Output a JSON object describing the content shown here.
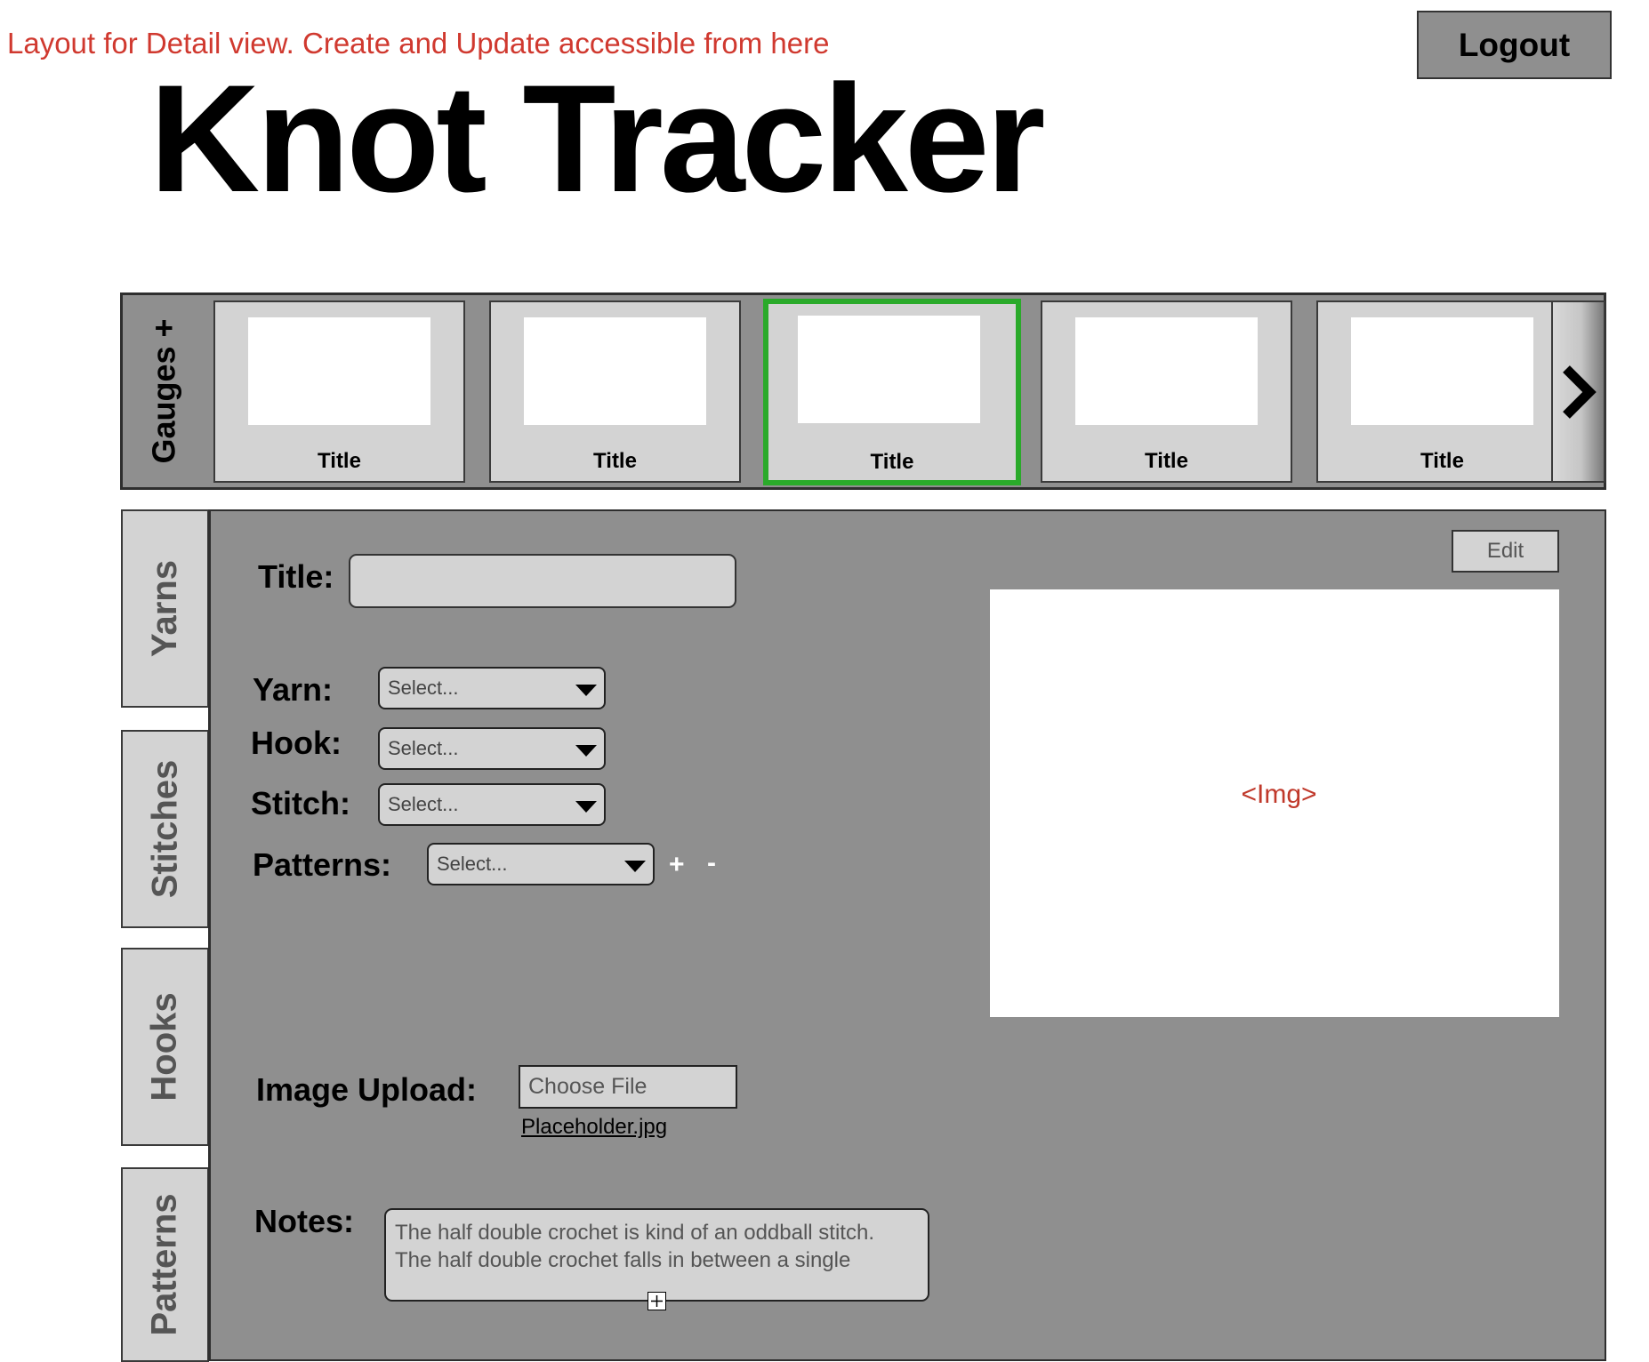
{
  "header": {
    "note": "Layout for Detail view. Create and Update accessible from here",
    "app_title": "Knot Tracker",
    "logout_label": "Logout"
  },
  "gauges": {
    "label": "Gauges",
    "add_label": "+",
    "cards": [
      {
        "title": "Title",
        "selected": false
      },
      {
        "title": "Title",
        "selected": false
      },
      {
        "title": "Title",
        "selected": true
      },
      {
        "title": "Title",
        "selected": false
      },
      {
        "title": "Title",
        "selected": false
      }
    ],
    "selected_color": "#2aaa2a"
  },
  "sidebar": {
    "tabs": [
      {
        "label": "Yarns"
      },
      {
        "label": "Stitches"
      },
      {
        "label": "Hooks"
      },
      {
        "label": "Patterns"
      }
    ]
  },
  "detail": {
    "edit_label": "Edit",
    "title_label": "Title:",
    "title_value": "",
    "yarn_label": "Yarn:",
    "yarn_value": "Select...",
    "hook_label": "Hook:",
    "hook_value": "Select...",
    "stitch_label": "Stitch:",
    "stitch_value": "Select...",
    "patterns_label": "Patterns:",
    "patterns_value": "Select...",
    "patterns_add": "+",
    "patterns_remove": "-",
    "image_placeholder": "<Img>",
    "image_upload_label": "Image Upload:",
    "choose_file_label": "Choose File",
    "file_name": "Placeholder.jpg",
    "notes_label": "Notes:",
    "notes_text_line1": "The half double crochet is kind of an oddball stitch.",
    "notes_text_line2": "The half double crochet falls in between a single"
  },
  "colors": {
    "panel": "#8f8f8f",
    "card": "#d3d3d3",
    "note_red": "#d0392f"
  }
}
